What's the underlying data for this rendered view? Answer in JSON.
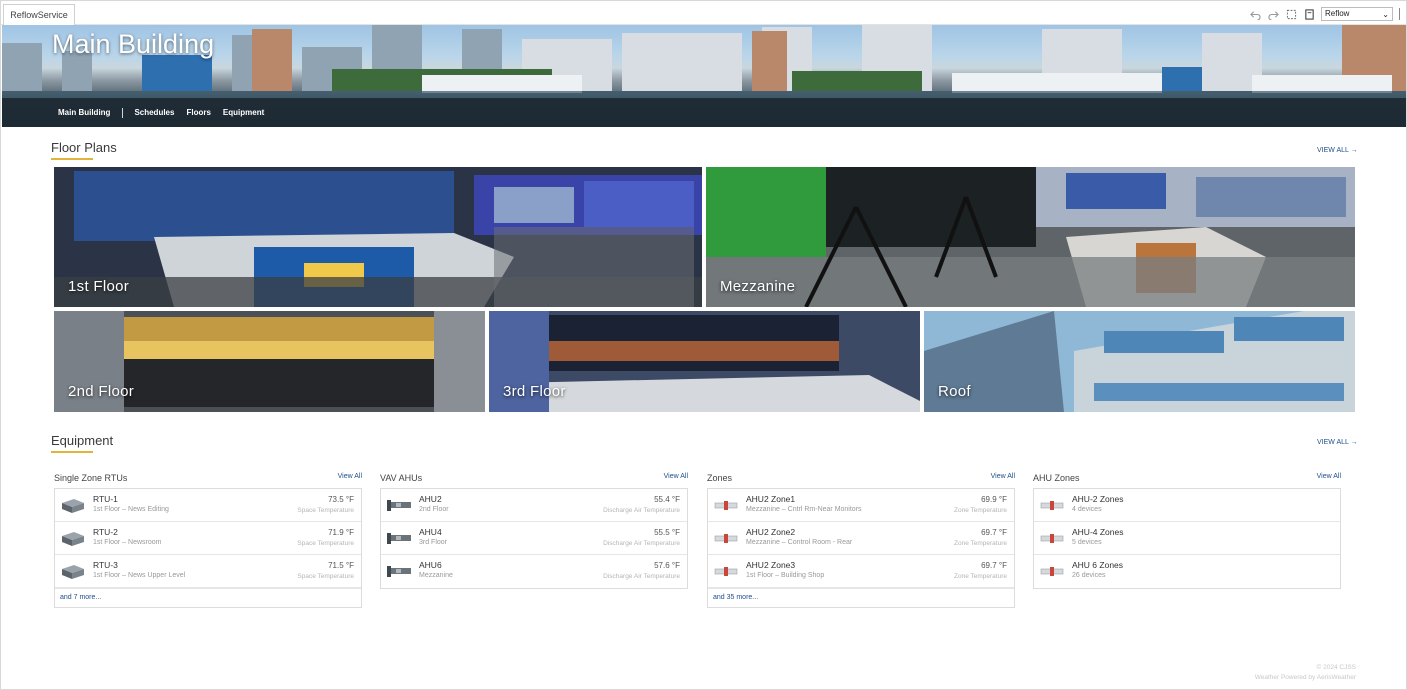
{
  "tab": {
    "label": "ReflowService"
  },
  "toolbar": {
    "view_selected": "Reflow"
  },
  "hero": {
    "title": "Main Building",
    "nav": [
      "Main Building",
      "Schedules",
      "Floors",
      "Equipment"
    ]
  },
  "floor_plans": {
    "title": "Floor Plans",
    "view_all": "VIEW ALL →",
    "tiles": [
      "1st Floor",
      "Mezzanine",
      "2nd Floor",
      "3rd Floor",
      "Roof"
    ]
  },
  "equipment": {
    "title": "Equipment",
    "view_all": "VIEW ALL →",
    "groups": [
      {
        "title": "Single Zone RTUs",
        "view_all": "View All",
        "rows": [
          {
            "name": "RTU-1",
            "sub": "1st Floor – News Editing",
            "value": "73.5 °F",
            "point": "Space Temperature"
          },
          {
            "name": "RTU-2",
            "sub": "1st Floor – Newsroom",
            "value": "71.9 °F",
            "point": "Space Temperature"
          },
          {
            "name": "RTU-3",
            "sub": "1st Floor – News Upper Level",
            "value": "71.5 °F",
            "point": "Space Temperature"
          }
        ],
        "more": "and 7 more..."
      },
      {
        "title": "VAV AHUs",
        "view_all": "View All",
        "rows": [
          {
            "name": "AHU2",
            "sub": "2nd Floor",
            "value": "55.4 °F",
            "point": "Discharge Air Temperature"
          },
          {
            "name": "AHU4",
            "sub": "3rd Floor",
            "value": "55.5 °F",
            "point": "Discharge Air Temperature"
          },
          {
            "name": "AHU6",
            "sub": "Mezzanine",
            "value": "57.6 °F",
            "point": "Discharge Air Temperature"
          }
        ],
        "more": ""
      },
      {
        "title": "Zones",
        "view_all": "View All",
        "rows": [
          {
            "name": "AHU2 Zone1",
            "sub": "Mezzanine – Cntrl Rm-Near Monitors",
            "value": "69.9 °F",
            "point": "Zone Temperature"
          },
          {
            "name": "AHU2 Zone2",
            "sub": "Mezzanine – Control Room - Rear",
            "value": "69.7 °F",
            "point": "Zone Temperature"
          },
          {
            "name": "AHU2 Zone3",
            "sub": "1st Floor – Building Shop",
            "value": "69.7 °F",
            "point": "Zone Temperature"
          }
        ],
        "more": "and 35 more..."
      },
      {
        "title": "AHU Zones",
        "view_all": "View All",
        "rows": [
          {
            "name": "AHU-2 Zones",
            "sub": "4 devices",
            "value": "",
            "point": ""
          },
          {
            "name": "AHU-4 Zones",
            "sub": "5 devices",
            "value": "",
            "point": ""
          },
          {
            "name": "AHU 6 Zones",
            "sub": "26 devices",
            "value": "",
            "point": ""
          }
        ],
        "more": ""
      }
    ]
  },
  "footer": {
    "line1": "© 2024 CJSS",
    "line2": "Weather Powered by AerisWeather"
  },
  "colors": {
    "accent": "#e2b43a",
    "link": "#1c4f8a"
  }
}
